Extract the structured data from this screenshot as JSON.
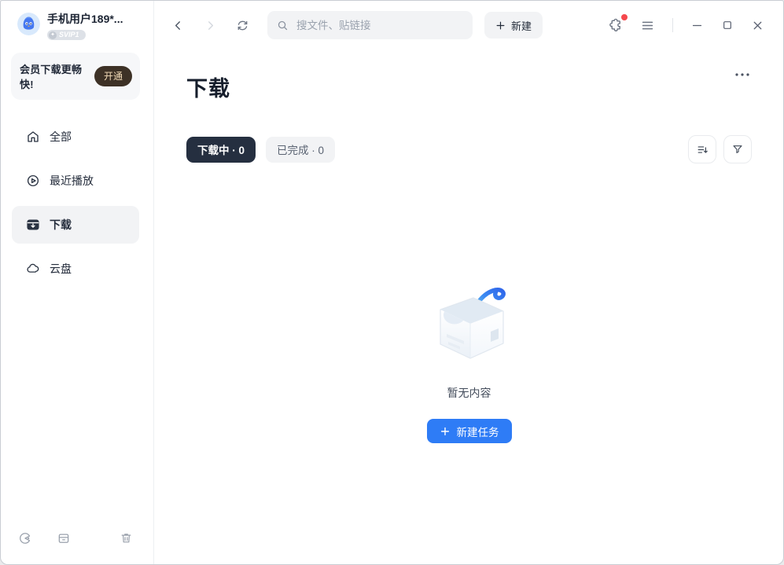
{
  "colors": {
    "accent_blue": "#2E7CF6",
    "active_tab_bg": "#252F40",
    "vip_button_bg": "#3D3126",
    "vip_button_text": "#F3DCB8",
    "notification_red": "#F5484D",
    "pill_gray_bg": "#F2F3F5"
  },
  "icons": {
    "back": "chevron-left",
    "forward": "chevron-right",
    "refresh": "sync-arrows",
    "search": "magnifier",
    "new": "plus",
    "puzzle": "puzzle-piece",
    "menu": "hamburger",
    "minimize": "—",
    "maximize": "□",
    "close": "×",
    "more": "⋯",
    "sort": "list-with-down-arrow",
    "filter": "funnel",
    "home": "house",
    "recent": "play-circle",
    "download": "download-box",
    "cloud": "cloud",
    "cleanup": "pie-circle-dot",
    "archive": "storage-box",
    "trash": "trash-can",
    "empty_state": "open-box-with-blue-swoosh"
  },
  "sidebar": {
    "user": {
      "name": "手机用户189*...",
      "badge": "SVIP1"
    },
    "member_banner": {
      "text": "会员下载更畅快!",
      "action_label": "开通"
    },
    "items": [
      {
        "label": "全部",
        "icon": "home-icon",
        "active": false
      },
      {
        "label": "最近播放",
        "icon": "play-circle-icon",
        "active": false
      },
      {
        "label": "下载",
        "icon": "download-box-icon",
        "active": true
      },
      {
        "label": "云盘",
        "icon": "cloud-icon",
        "active": false
      }
    ],
    "footer_icons": [
      "cleanup-icon",
      "archive-box-icon",
      "trash-icon"
    ]
  },
  "topbar": {
    "search_placeholder": "搜文件、贴链接",
    "new_button_label": "新建"
  },
  "content": {
    "title": "下载",
    "tabs": [
      {
        "label": "下载中 · 0",
        "active": true
      },
      {
        "label": "已完成 · 0",
        "active": false
      }
    ],
    "empty_state": {
      "message": "暂无内容",
      "action_label": "新建任务"
    }
  }
}
